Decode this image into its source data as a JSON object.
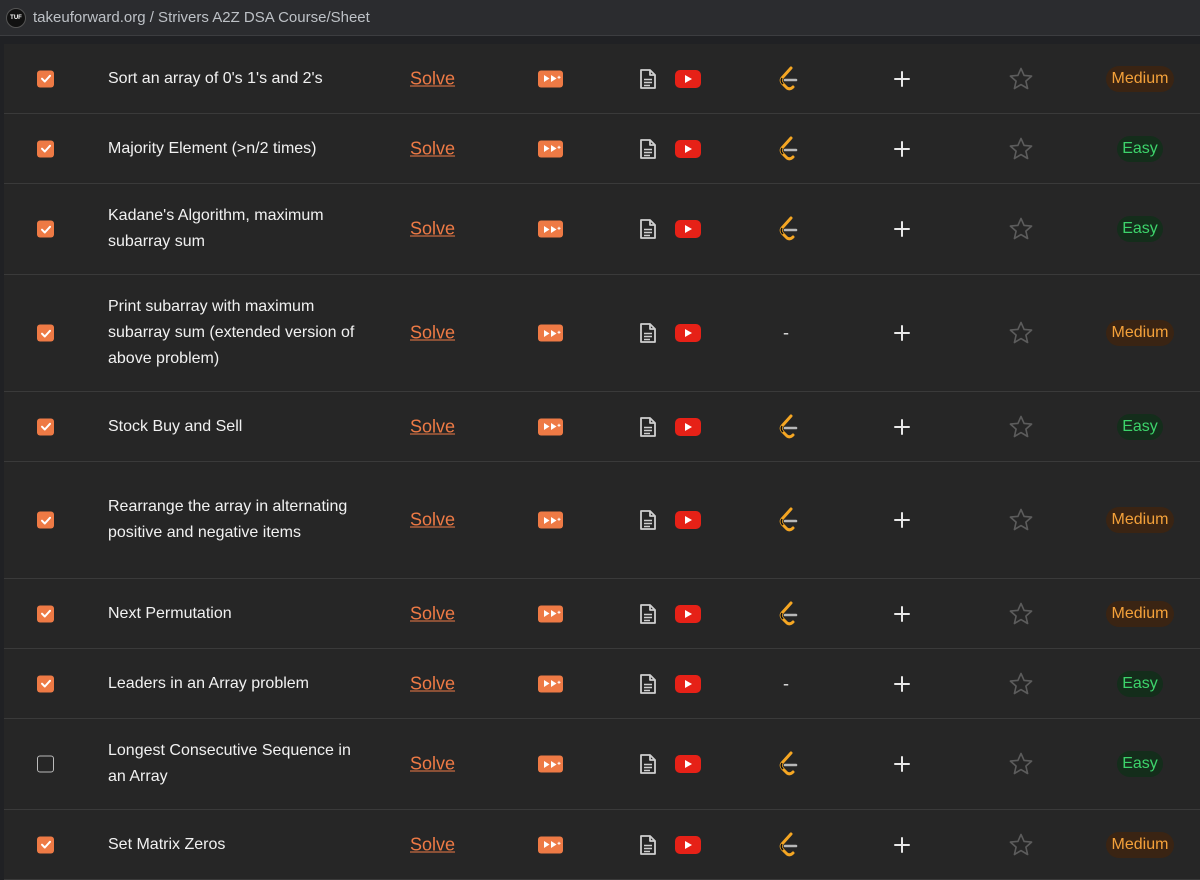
{
  "browser": {
    "site_logo_text": "TUF",
    "breadcrumb": "takeuforward.org / Strivers A2Z DSA Course/Sheet"
  },
  "colors": {
    "accent": "#ee7a45",
    "medium": "#f4a13a",
    "easy": "#3dd36b",
    "youtube": "#e62117"
  },
  "rows": [
    {
      "title": "Sort an array of 0's 1's and 2's",
      "checked": true,
      "solve": "Solve",
      "leetcode": true,
      "difficulty": "Medium"
    },
    {
      "title": "Majority Element (>n/2 times)",
      "checked": true,
      "solve": "Solve",
      "leetcode": true,
      "difficulty": "Easy"
    },
    {
      "title": "Kadane's Algorithm, maximum subarray sum",
      "checked": true,
      "solve": "Solve",
      "leetcode": true,
      "difficulty": "Easy"
    },
    {
      "title": "Print subarray with maximum subarray sum (extended version of above problem)",
      "checked": true,
      "solve": "Solve",
      "leetcode": false,
      "leetcode_placeholder": "-",
      "difficulty": "Medium"
    },
    {
      "title": "Stock Buy and Sell",
      "checked": true,
      "solve": "Solve",
      "leetcode": true,
      "difficulty": "Easy"
    },
    {
      "title": "Rearrange the array in alternating positive and negative items",
      "checked": true,
      "solve": "Solve",
      "leetcode": true,
      "difficulty": "Medium"
    },
    {
      "title": "Next Permutation",
      "checked": true,
      "solve": "Solve",
      "leetcode": true,
      "difficulty": "Medium"
    },
    {
      "title": "Leaders in an Array problem",
      "checked": true,
      "solve": "Solve",
      "leetcode": false,
      "leetcode_placeholder": "-",
      "difficulty": "Easy"
    },
    {
      "title": "Longest Consecutive Sequence in an Array",
      "checked": false,
      "solve": "Solve",
      "leetcode": true,
      "difficulty": "Easy"
    },
    {
      "title": "Set Matrix Zeros",
      "checked": true,
      "solve": "Solve",
      "leetcode": true,
      "difficulty": "Medium"
    }
  ]
}
